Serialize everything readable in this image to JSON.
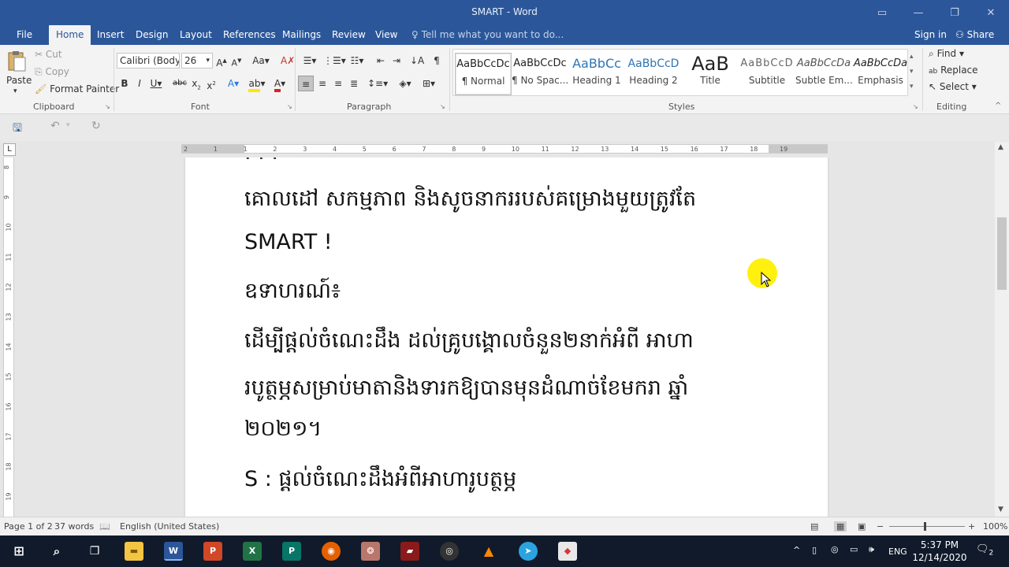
{
  "window": {
    "title": "SMART - Word"
  },
  "tabs": [
    {
      "label": "File"
    },
    {
      "label": "Home"
    },
    {
      "label": "Insert"
    },
    {
      "label": "Design"
    },
    {
      "label": "Layout"
    },
    {
      "label": "References"
    },
    {
      "label": "Mailings"
    },
    {
      "label": "Review"
    },
    {
      "label": "View"
    }
  ],
  "tellme": "Tell me what you want to do...",
  "signin": "Sign in",
  "share": "Share",
  "clipboard": {
    "paste": "Paste",
    "cut": "Cut",
    "copy": "Copy",
    "format_painter": "Format Painter",
    "label": "Clipboard"
  },
  "font": {
    "name": "Calibri (Body)",
    "size": "26",
    "label": "Font"
  },
  "paragraph": {
    "label": "Paragraph"
  },
  "styles": {
    "label": "Styles",
    "items": [
      {
        "sample": "AaBbCcDc",
        "name": "¶ Normal"
      },
      {
        "sample": "AaBbCcDc",
        "name": "¶ No Spac..."
      },
      {
        "sample": "AaBbCc",
        "name": "Heading 1"
      },
      {
        "sample": "AaBbCcD",
        "name": "Heading 2"
      },
      {
        "sample": "AaB",
        "name": "Title"
      },
      {
        "sample": "AaBbCcD",
        "name": "Subtitle"
      },
      {
        "sample": "AaBbCcDa",
        "name": "Subtle Em..."
      },
      {
        "sample": "AaBbCcDa",
        "name": "Emphasis"
      }
    ]
  },
  "editing": {
    "find": "Find",
    "replace": "Replace",
    "select": "Select",
    "label": "Editing"
  },
  "ruler": {
    "h_ticks": [
      "2",
      "1",
      "1",
      "2",
      "3",
      "4",
      "5",
      "6",
      "7",
      "8",
      "9",
      "10",
      "11",
      "12",
      "13",
      "14",
      "15",
      "16",
      "17",
      "18",
      "19"
    ],
    "v_ticks": [
      "8",
      "9",
      "10",
      "11",
      "12",
      "13",
      "14",
      "15",
      "16",
      "17",
      "18",
      "19"
    ]
  },
  "document": {
    "lines": [
      "គោលដៅ សកម្មភាព និងសូចនាកររបស់គម្រោងមួយត្រូវតែ",
      "SMART !",
      "ឧទាហរណ៍៖",
      "ដើម្បីផ្តល់ចំណេះដឹង ដល់គ្រូបង្គោលចំនួន២នាក់អំពី  អាហា",
      "របូត្ថម្ភសម្រាប់មាតានិងទារកឱ្យបានមុនដំណាច់ខែមករា ឆ្នាំ",
      "២០២១។",
      "S : ផ្តល់ចំណេះដឹងអំពីអាហារូបត្ថម្ភ"
    ]
  },
  "status": {
    "page": "Page 1 of 2",
    "words": "37 words",
    "language": "English (United States)",
    "zoom": "100%"
  },
  "taskbar": {
    "lang": "ENG",
    "time": "5:37 PM",
    "date": "12/14/2020",
    "notifications": "2"
  }
}
